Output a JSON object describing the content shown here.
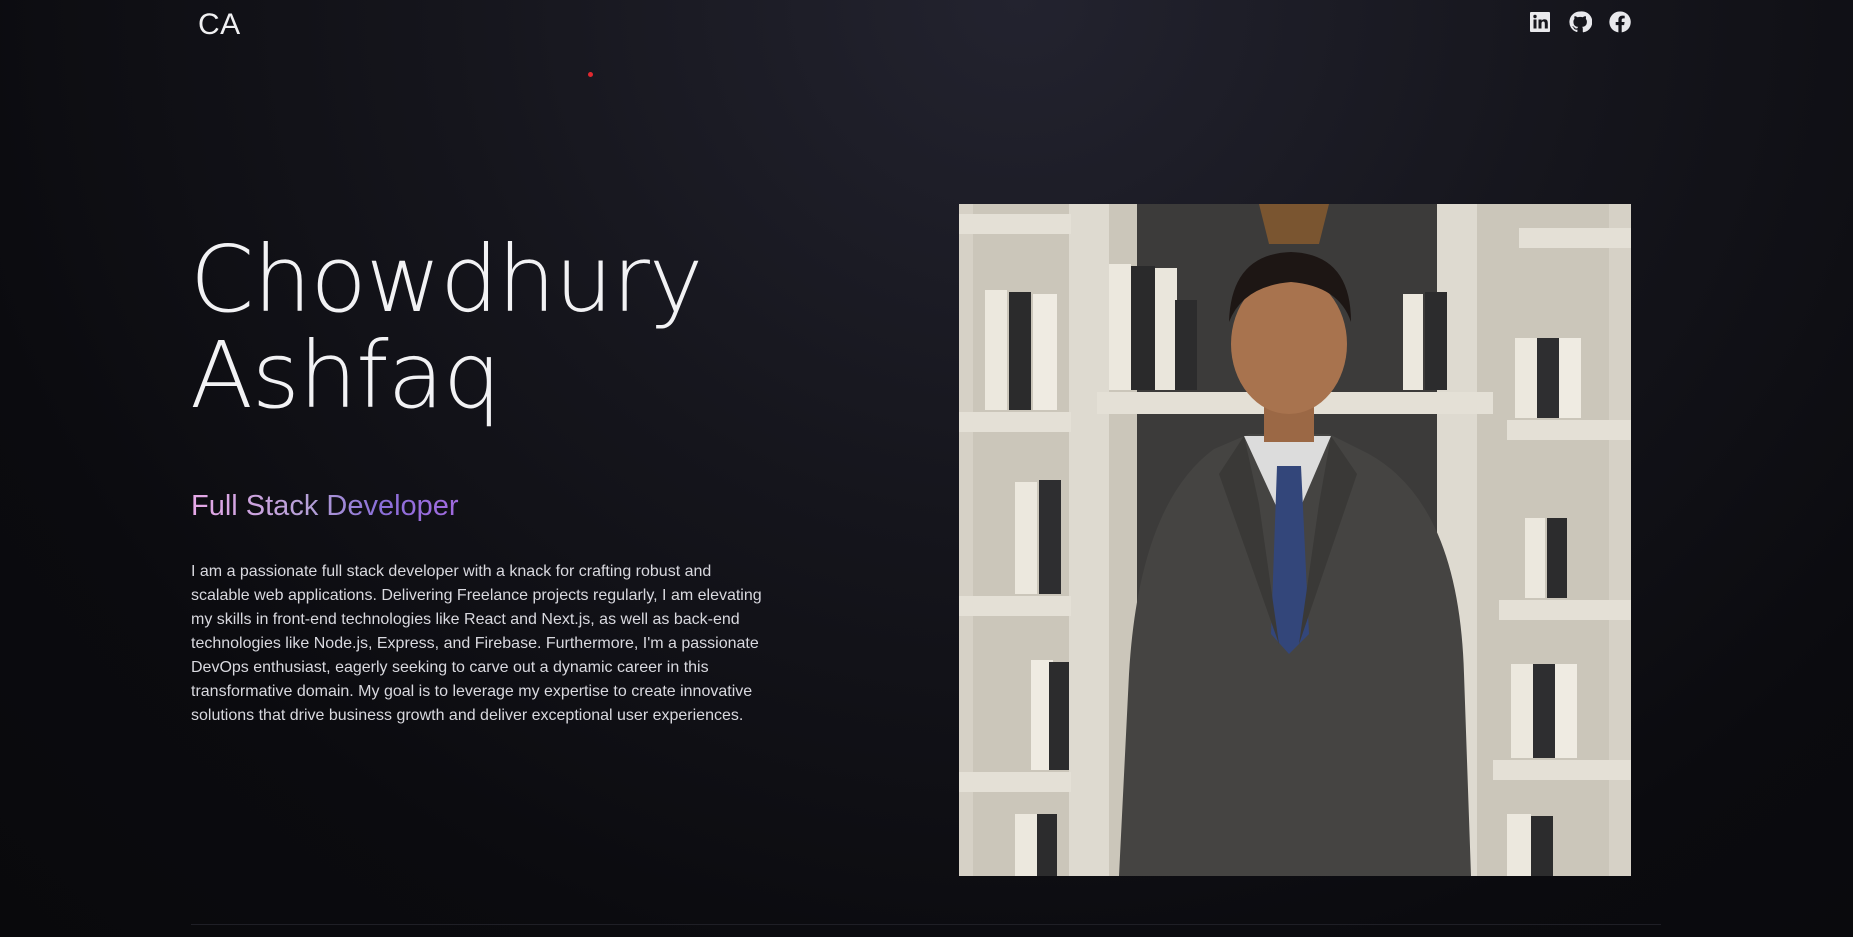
{
  "header": {
    "logo": "CA",
    "social": [
      {
        "name": "linkedin-icon",
        "label": "LinkedIn"
      },
      {
        "name": "github-icon",
        "label": "GitHub"
      },
      {
        "name": "facebook-icon",
        "label": "Facebook"
      }
    ]
  },
  "hero": {
    "first_name": "Chowdhury",
    "last_name": "Ashfaq",
    "role": "Full Stack Developer",
    "bio": "I am a passionate full stack developer with a knack for crafting robust and scalable web applications. Delivering Freelance projects regularly, I am elevating my skills in front-end technologies like React and Next.js, as well as back-end technologies like Node.js, Express, and Firebase. Furthermore, I'm a passionate DevOps enthusiast, eagerly seeking to carve out a dynamic career in this transformative domain. My goal is to leverage my expertise to create innovative solutions that drive business growth and deliver exceptional user experiences."
  },
  "colors": {
    "background": "#0b0b0f",
    "accent_dot": "#e0282f",
    "role_gradient_start": "#e7a8e8",
    "role_gradient_end": "#a16ae0"
  }
}
